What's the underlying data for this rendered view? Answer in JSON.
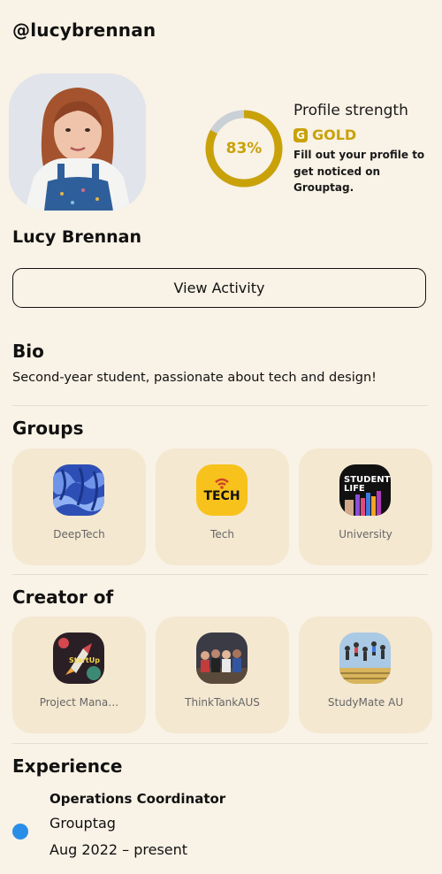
{
  "profile": {
    "handle": "@lucybrennan",
    "full_name": "Lucy Brennan",
    "avatar_icon": "person-photo"
  },
  "strength": {
    "title": "Profile strength",
    "percent_label": "83%",
    "percent_value": 83,
    "tier": "GOLD",
    "tier_icon": "g-badge-icon",
    "hint": "Fill out your profile to get noticed on Grouptag.",
    "accent_color": "#c9a20a",
    "track_color": "#c9d0d6"
  },
  "actions": {
    "view_activity": "View Activity"
  },
  "bio": {
    "title": "Bio",
    "text": "Second-year student, passionate about tech and design!"
  },
  "groups": {
    "title": "Groups",
    "items": [
      {
        "label": "DeepTech",
        "icon": "blue-fabric-thumbnail"
      },
      {
        "label": "Tech",
        "icon": "tech-wifi-thumbnail"
      },
      {
        "label": "University",
        "icon": "student-life-thumbnail"
      }
    ]
  },
  "creator": {
    "title": "Creator of",
    "items": [
      {
        "label": "Project Mana…",
        "icon": "startup-rocket-thumbnail"
      },
      {
        "label": "ThinkTankAUS",
        "icon": "group-photo-thumbnail"
      },
      {
        "label": "StudyMate AU",
        "icon": "jumping-students-thumbnail"
      }
    ]
  },
  "experience": {
    "title": "Experience",
    "items": [
      {
        "role": "Operations Coordinator",
        "company": "Grouptag",
        "dates": "Aug 2022 – present",
        "dot_color": "#2a8ee8"
      }
    ]
  },
  "colors": {
    "background": "#f9f2e6",
    "card": "#f4e8d1",
    "text": "#111111"
  }
}
